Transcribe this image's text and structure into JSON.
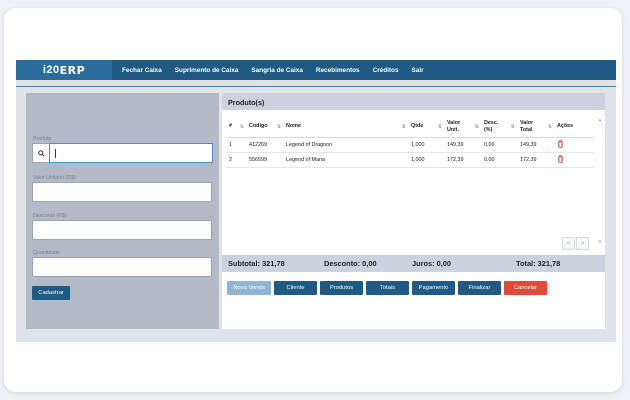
{
  "nav": {
    "logo_prefix": "i20",
    "logo_suffix": "ERP",
    "items": [
      "Fechar Caixa",
      "Suprimento de Caixa",
      "Sangria de Caixa",
      "Recebimentos",
      "Créditos",
      "Sair"
    ]
  },
  "form": {
    "produto_label": "Produto",
    "valor_unitario_label": "Valor Unitário (R$)",
    "desconto_label": "Desconto (R$)",
    "quantidade_label": "Quantidade",
    "submit_label": "Cadastrar"
  },
  "products": {
    "title": "Produto(s)",
    "columns": [
      "#",
      "Código",
      "Nome",
      "Qtde",
      "Valor Unit.",
      "Desc. (%)",
      "Valor Total",
      "Ações"
    ],
    "rows": [
      {
        "n": "1",
        "codigo": "412269",
        "nome": "Legend of Dragoon",
        "qtde": "1,000",
        "valor_unit": "149,39",
        "desc": "0,00",
        "valor_total": "149,39"
      },
      {
        "n": "2",
        "codigo": "556599",
        "nome": "Legend of Mana",
        "qtde": "1,000",
        "valor_unit": "172,39",
        "desc": "0,00",
        "valor_total": "172,39"
      }
    ],
    "pager_prev": "<",
    "pager_next": ">"
  },
  "totals": {
    "subtotal": "Subtotal: 321,78",
    "desconto": "Desconto: 0,00",
    "juros": "Juros: 0,00",
    "total": "Total: 321,78"
  },
  "actions": [
    "Nova Venda",
    "Cliente",
    "Produtos",
    "Totais",
    "Pagamento",
    "Finalizar",
    "Cancelar"
  ],
  "colors": {
    "nav": "#1e5a84",
    "cancel": "#e04a3a",
    "nova_venda": "#8fb4d4"
  }
}
